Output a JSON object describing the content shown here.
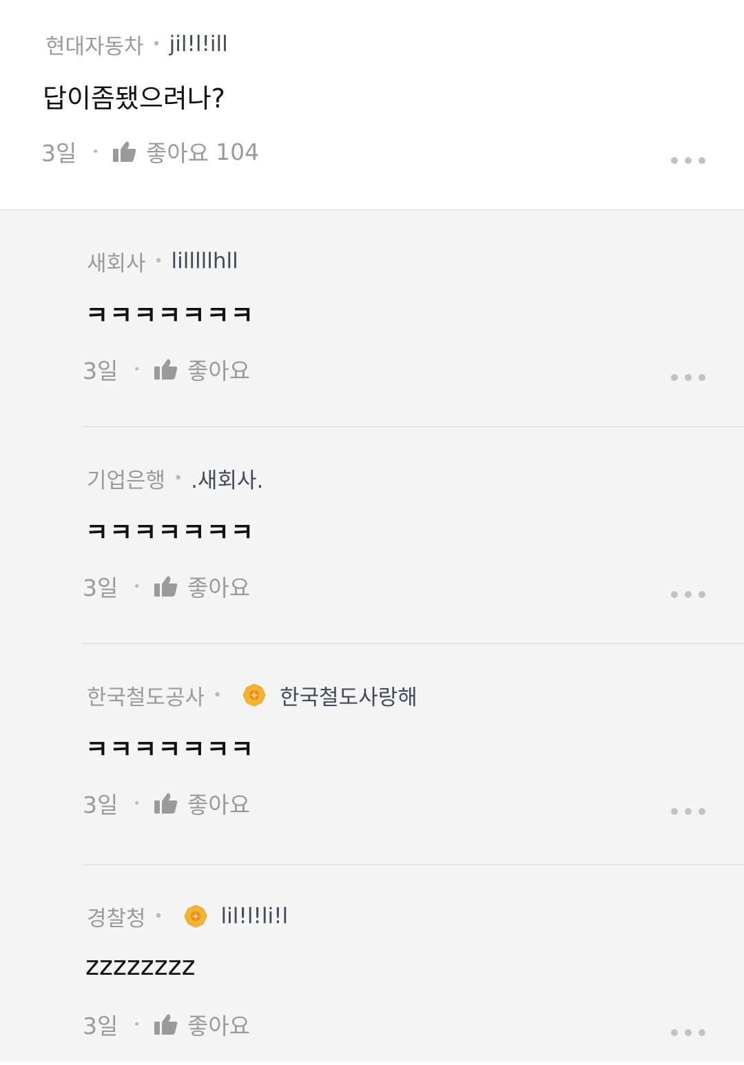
{
  "main_comment": {
    "company": "현대자동차",
    "nickname": "jil!l!ill",
    "text": "답이좀됐으려나?",
    "time": "3일",
    "like_label": "좋아요",
    "like_count": "104"
  },
  "replies": [
    {
      "company": "새회사",
      "nickname": "lilllllhll",
      "badge": false,
      "text": "ㅋㅋㅋㅋㅋㅋㅋ",
      "time": "3일",
      "like_label": "좋아요"
    },
    {
      "company": "기업은행",
      "nickname": ".새회사.",
      "badge": false,
      "text": "ㅋㅋㅋㅋㅋㅋㅋ",
      "time": "3일",
      "like_label": "좋아요"
    },
    {
      "company": "한국철도공사",
      "nickname": "한국철도사랑해",
      "badge": true,
      "text": "ㅋㅋㅋㅋㅋㅋㅋ",
      "time": "3일",
      "like_label": "좋아요"
    },
    {
      "company": "경찰청",
      "nickname": "lil!l!li!l",
      "badge": true,
      "text": "zzzzzzzz",
      "time": "3일",
      "like_label": "좋아요"
    }
  ],
  "icons": {
    "thumb": "thumbs-up-icon",
    "more": "more-dots-icon",
    "badge": "gold-badge-icon"
  },
  "colors": {
    "reply_background": "#f4f4f4",
    "badge_gold": "#f3b431",
    "muted_text": "#9a9a9a"
  }
}
